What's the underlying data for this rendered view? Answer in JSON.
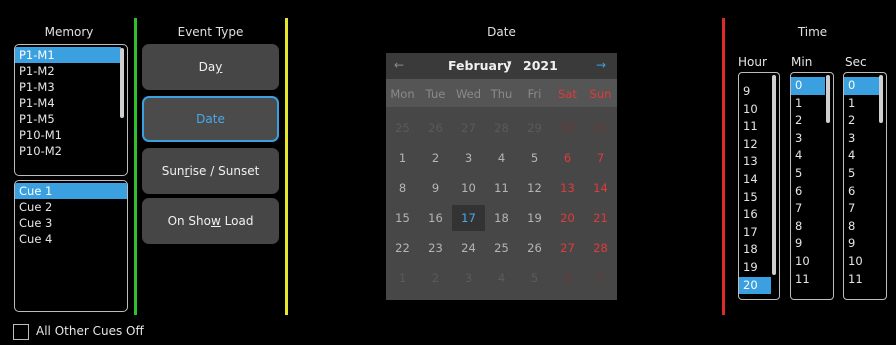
{
  "memory": {
    "header": "Memory",
    "items": [
      "P1-M1",
      "P1-M2",
      "P1-M3",
      "P1-M4",
      "P1-M5",
      "P10-M1",
      "P10-M2"
    ],
    "selected": "P1-M1"
  },
  "cues": {
    "items": [
      "Cue 1",
      "Cue 2",
      "Cue 3",
      "Cue 4"
    ],
    "selected": "Cue 1"
  },
  "all_other_cues_off": {
    "label": "All Other Cues Off",
    "checked": false
  },
  "event_type": {
    "header": "Event Type",
    "buttons": [
      {
        "pre": "Da",
        "u": "y",
        "post": ""
      },
      {
        "pre": "Date",
        "u": "",
        "post": ""
      },
      {
        "pre": "Sun",
        "u": "r",
        "post": "ise / Sunset"
      },
      {
        "pre": "On Sho",
        "u": "w",
        "post": " Load"
      }
    ],
    "active": "Date"
  },
  "date": {
    "header": "Date",
    "prev_arrow": "←",
    "next_arrow": "→",
    "month": "February",
    "year": "2021",
    "weekdays": [
      "Mon",
      "Tue",
      "Wed",
      "Thu",
      "Fri",
      "Sat",
      "Sun"
    ],
    "weeks": [
      [
        "25",
        "26",
        "27",
        "28",
        "29",
        "30",
        "31"
      ],
      [
        "1",
        "2",
        "3",
        "4",
        "5",
        "6",
        "7"
      ],
      [
        "8",
        "9",
        "10",
        "11",
        "12",
        "13",
        "14"
      ],
      [
        "15",
        "16",
        "17",
        "18",
        "19",
        "20",
        "21"
      ],
      [
        "22",
        "23",
        "24",
        "25",
        "26",
        "27",
        "28"
      ],
      [
        "1",
        "2",
        "3",
        "4",
        "5",
        "6",
        "7"
      ]
    ],
    "selected_day": "17"
  },
  "time": {
    "header": "Time",
    "hour": {
      "label": "Hour",
      "items": [
        "9",
        "10",
        "11",
        "12",
        "13",
        "14",
        "15",
        "16",
        "17",
        "18",
        "19",
        "20"
      ],
      "selected": "20"
    },
    "min": {
      "label": "Min",
      "items": [
        "0",
        "1",
        "2",
        "3",
        "4",
        "5",
        "6",
        "7",
        "8",
        "9",
        "10",
        "11"
      ],
      "selected": "0"
    },
    "sec": {
      "label": "Sec",
      "items": [
        "0",
        "1",
        "2",
        "3",
        "4",
        "5",
        "6",
        "7",
        "8",
        "9",
        "10",
        "11"
      ],
      "selected": "0"
    }
  },
  "colors": {
    "accent": "#3aa0e0",
    "memory_divider": "#2ec02e",
    "event_divider": "#e6e62a",
    "date_divider": "#e02a2a",
    "weekend": "#e23a3a"
  }
}
